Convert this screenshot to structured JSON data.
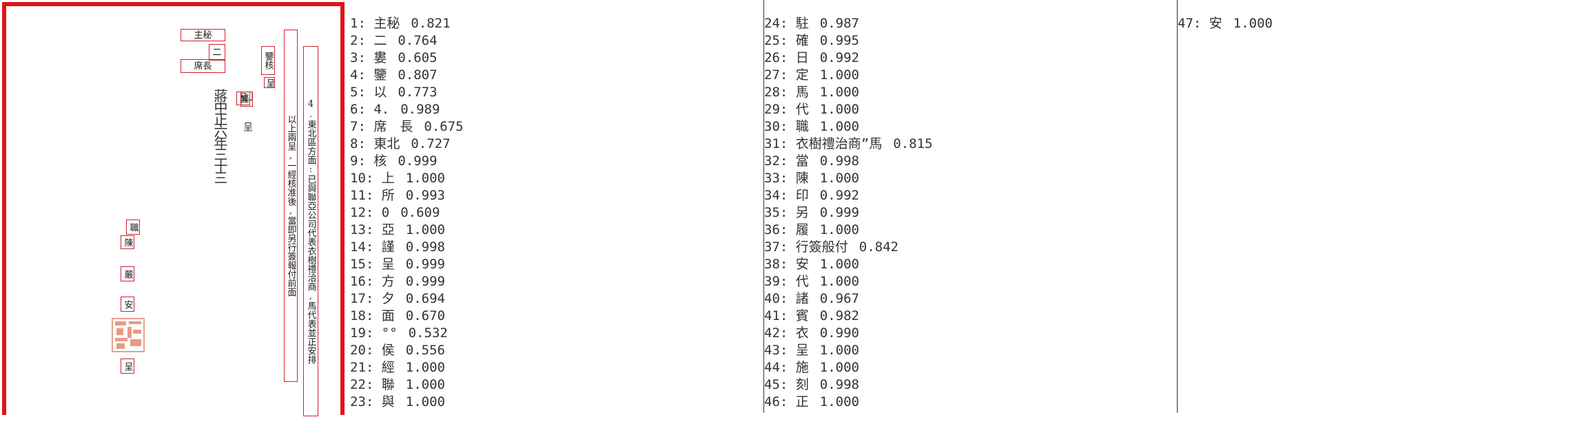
{
  "document": {
    "boxes": [
      {
        "text": "主秘",
        "vertical": false
      },
      {
        "text": "二",
        "vertical": false
      },
      {
        "text": "席長",
        "vertical": false
      },
      {
        "text": "鑒核",
        "vertical": true
      },
      {
        "text": "上呈",
        "vertical": true
      },
      {
        "text": "呈",
        "vertical": true
      },
      {
        "text": "以上兩呈,一經核准後,當即另行簽報付前面",
        "vertical": true
      },
      {
        "text": "4.東北區方面:已與聯亞公司代表衣樹禮洽商,馬代表並正安排",
        "vertical": true
      },
      {
        "text": "職",
        "vertical": true
      },
      {
        "text": "陳",
        "vertical": true
      },
      {
        "text": "嚴",
        "vertical": true
      },
      {
        "text": "安",
        "vertical": true
      },
      {
        "text": "呈",
        "vertical": true
      },
      {
        "text": "謹",
        "vertical": true
      }
    ],
    "handwriting": "蔣中正六年三十三"
  },
  "results": [
    {
      "index": "1:",
      "text": "主秘",
      "score": "0.821"
    },
    {
      "index": "2:",
      "text": "二",
      "score": "0.764"
    },
    {
      "index": "3:",
      "text": "婁",
      "score": "0.605"
    },
    {
      "index": "4:",
      "text": "鑒",
      "score": "0.807"
    },
    {
      "index": "5:",
      "text": "以",
      "score": "0.773"
    },
    {
      "index": "6:",
      "text": "4.",
      "score": "0.989"
    },
    {
      "index": "7:",
      "text": "席　長",
      "score": "0.675"
    },
    {
      "index": "8:",
      "text": "東北",
      "score": "0.727"
    },
    {
      "index": "9:",
      "text": "核",
      "score": "0.999"
    },
    {
      "index": "10:",
      "text": "上",
      "score": "1.000"
    },
    {
      "index": "11:",
      "text": "所",
      "score": "0.993"
    },
    {
      "index": "12:",
      "text": "0",
      "score": "0.609"
    },
    {
      "index": "13:",
      "text": "亞",
      "score": "1.000"
    },
    {
      "index": "14:",
      "text": "謹",
      "score": "0.998"
    },
    {
      "index": "15:",
      "text": "呈",
      "score": "0.999"
    },
    {
      "index": "16:",
      "text": "方",
      "score": "0.999"
    },
    {
      "index": "17:",
      "text": "夕",
      "score": "0.694"
    },
    {
      "index": "18:",
      "text": "面",
      "score": "0.670"
    },
    {
      "index": "19:",
      "text": "°°",
      "score": "0.532"
    },
    {
      "index": "20:",
      "text": "侯",
      "score": "0.556"
    },
    {
      "index": "21:",
      "text": "經",
      "score": "1.000"
    },
    {
      "index": "22:",
      "text": "聯",
      "score": "1.000"
    },
    {
      "index": "23:",
      "text": "與",
      "score": "1.000"
    },
    {
      "index": "24:",
      "text": "駐",
      "score": "0.987"
    },
    {
      "index": "25:",
      "text": "確",
      "score": "0.995"
    },
    {
      "index": "26:",
      "text": "日",
      "score": "0.992"
    },
    {
      "index": "27:",
      "text": "定",
      "score": "1.000"
    },
    {
      "index": "28:",
      "text": "馬",
      "score": "1.000"
    },
    {
      "index": "29:",
      "text": "代",
      "score": "1.000"
    },
    {
      "index": "30:",
      "text": "職",
      "score": "1.000"
    },
    {
      "index": "31:",
      "text": "衣樹禮治商”馬",
      "score": "0.815"
    },
    {
      "index": "32:",
      "text": "當",
      "score": "0.998"
    },
    {
      "index": "33:",
      "text": "陳",
      "score": "1.000"
    },
    {
      "index": "34:",
      "text": "印",
      "score": "0.992"
    },
    {
      "index": "35:",
      "text": "另",
      "score": "0.999"
    },
    {
      "index": "36:",
      "text": "履",
      "score": "1.000"
    },
    {
      "index": "37:",
      "text": "行簽般付",
      "score": "0.842"
    },
    {
      "index": "38:",
      "text": "安",
      "score": "1.000"
    },
    {
      "index": "39:",
      "text": "代",
      "score": "1.000"
    },
    {
      "index": "40:",
      "text": "諸",
      "score": "0.967"
    },
    {
      "index": "41:",
      "text": "賓",
      "score": "0.982"
    },
    {
      "index": "42:",
      "text": "衣",
      "score": "0.990"
    },
    {
      "index": "43:",
      "text": "呈",
      "score": "1.000"
    },
    {
      "index": "44:",
      "text": "施",
      "score": "1.000"
    },
    {
      "index": "45:",
      "text": "刻",
      "score": "0.998"
    },
    {
      "index": "46:",
      "text": "正",
      "score": "1.000"
    },
    {
      "index": "47:",
      "text": "安",
      "score": "1.000"
    }
  ],
  "colors": {
    "box": "#d02030",
    "frame": "#e0141a",
    "separator": "#333333"
  }
}
